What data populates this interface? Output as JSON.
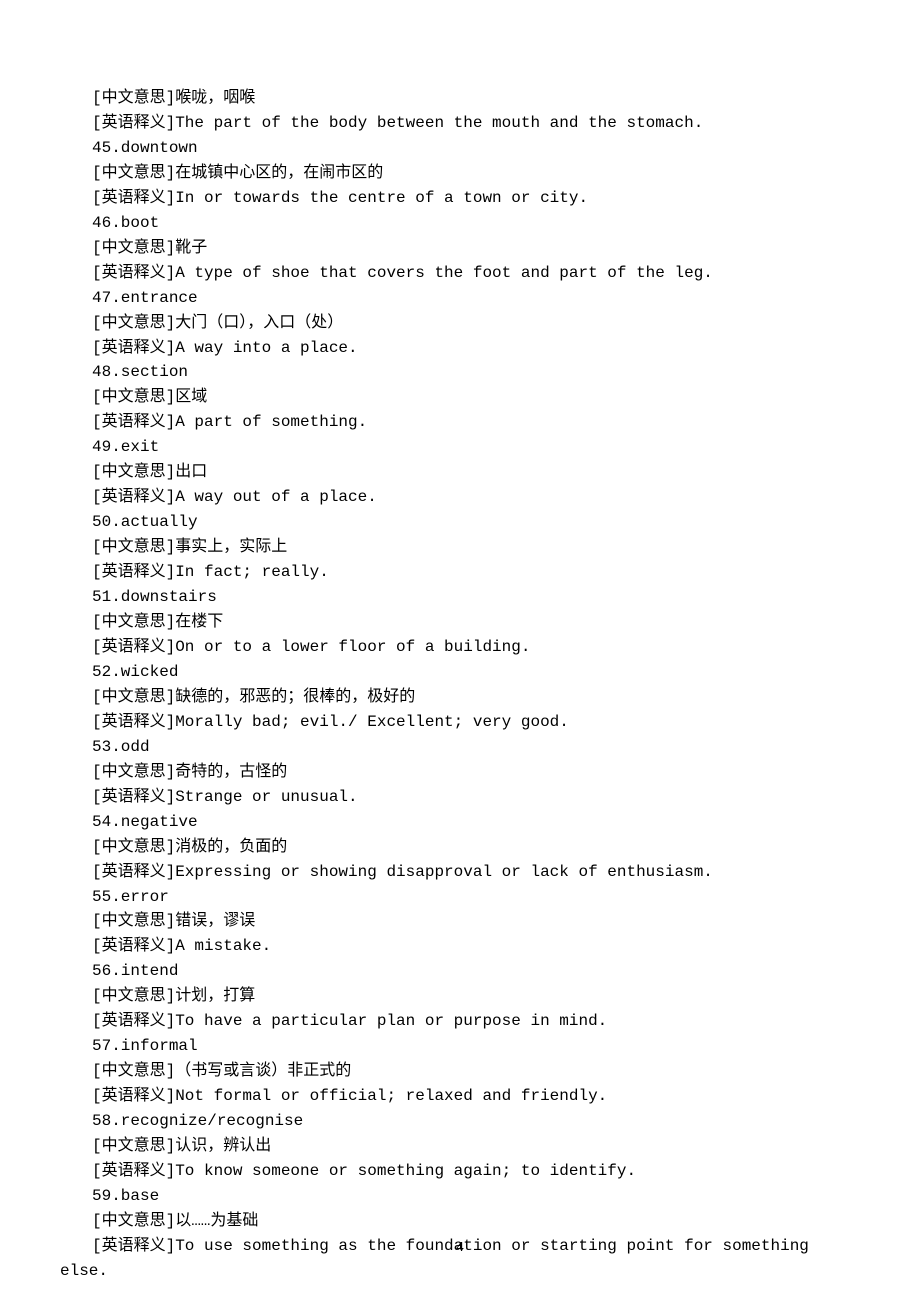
{
  "pageNumber": "4",
  "lines": [
    {
      "indent": true,
      "text": "[中文意思]喉咙，咽喉"
    },
    {
      "indent": true,
      "text": "[英语释义]The part of the body between the mouth and the stomach."
    },
    {
      "indent": true,
      "text": "45.downtown"
    },
    {
      "indent": true,
      "text": "[中文意思]在城镇中心区的，在闹市区的"
    },
    {
      "indent": true,
      "text": "[英语释义]In or towards the centre of a town or city."
    },
    {
      "indent": true,
      "text": "46.boot"
    },
    {
      "indent": true,
      "text": "[中文意思]靴子"
    },
    {
      "indent": true,
      "text": "[英语释义]A type of shoe that covers the foot and part of the leg."
    },
    {
      "indent": true,
      "text": "47.entrance"
    },
    {
      "indent": true,
      "text": "[中文意思]大门（口），入口（处）"
    },
    {
      "indent": true,
      "text": "[英语释义]A way into a place."
    },
    {
      "indent": true,
      "text": "48.section"
    },
    {
      "indent": true,
      "text": "[中文意思]区域"
    },
    {
      "indent": true,
      "text": "[英语释义]A part of something."
    },
    {
      "indent": true,
      "text": "49.exit"
    },
    {
      "indent": true,
      "text": "[中文意思]出口"
    },
    {
      "indent": true,
      "text": "[英语释义]A way out of a place."
    },
    {
      "indent": true,
      "text": "50.actually"
    },
    {
      "indent": true,
      "text": "[中文意思]事实上，实际上"
    },
    {
      "indent": true,
      "text": "[英语释义]In fact; really."
    },
    {
      "indent": true,
      "text": "51.downstairs"
    },
    {
      "indent": true,
      "text": "[中文意思]在楼下"
    },
    {
      "indent": true,
      "text": "[英语释义]On or to a lower floor of a building."
    },
    {
      "indent": true,
      "text": "52.wicked"
    },
    {
      "indent": true,
      "text": "[中文意思]缺德的，邪恶的；很棒的，极好的"
    },
    {
      "indent": true,
      "text": "[英语释义]Morally bad; evil./ Excellent; very good."
    },
    {
      "indent": true,
      "text": "53.odd"
    },
    {
      "indent": true,
      "text": "[中文意思]奇特的，古怪的"
    },
    {
      "indent": true,
      "text": "[英语释义]Strange or unusual."
    },
    {
      "indent": true,
      "text": "54.negative"
    },
    {
      "indent": true,
      "text": "[中文意思]消极的，负面的"
    },
    {
      "indent": true,
      "text": "[英语释义]Expressing or showing disapproval or lack of enthusiasm."
    },
    {
      "indent": true,
      "text": "55.error"
    },
    {
      "indent": true,
      "text": "[中文意思]错误，谬误"
    },
    {
      "indent": true,
      "text": "[英语释义]A mistake."
    },
    {
      "indent": true,
      "text": "56.intend"
    },
    {
      "indent": true,
      "text": "[中文意思]计划，打算"
    },
    {
      "indent": true,
      "text": "[英语释义]To have a particular plan or purpose in mind."
    },
    {
      "indent": true,
      "text": "57.informal"
    },
    {
      "indent": true,
      "text": "[中文意思]（书写或言谈）非正式的"
    },
    {
      "indent": true,
      "text": "[英语释义]Not formal or official; relaxed and friendly."
    },
    {
      "indent": true,
      "text": "58.recognize/recognise"
    },
    {
      "indent": true,
      "text": "[中文意思]认识，辨认出"
    },
    {
      "indent": true,
      "text": "[英语释义]To know someone or something again; to identify."
    },
    {
      "indent": true,
      "text": "59.base"
    },
    {
      "indent": true,
      "text": "[中文意思]以……为基础"
    },
    {
      "indent": true,
      "text": "[英语释义]To use something as the foundation or starting point for something "
    },
    {
      "indent": false,
      "text": "else."
    }
  ]
}
